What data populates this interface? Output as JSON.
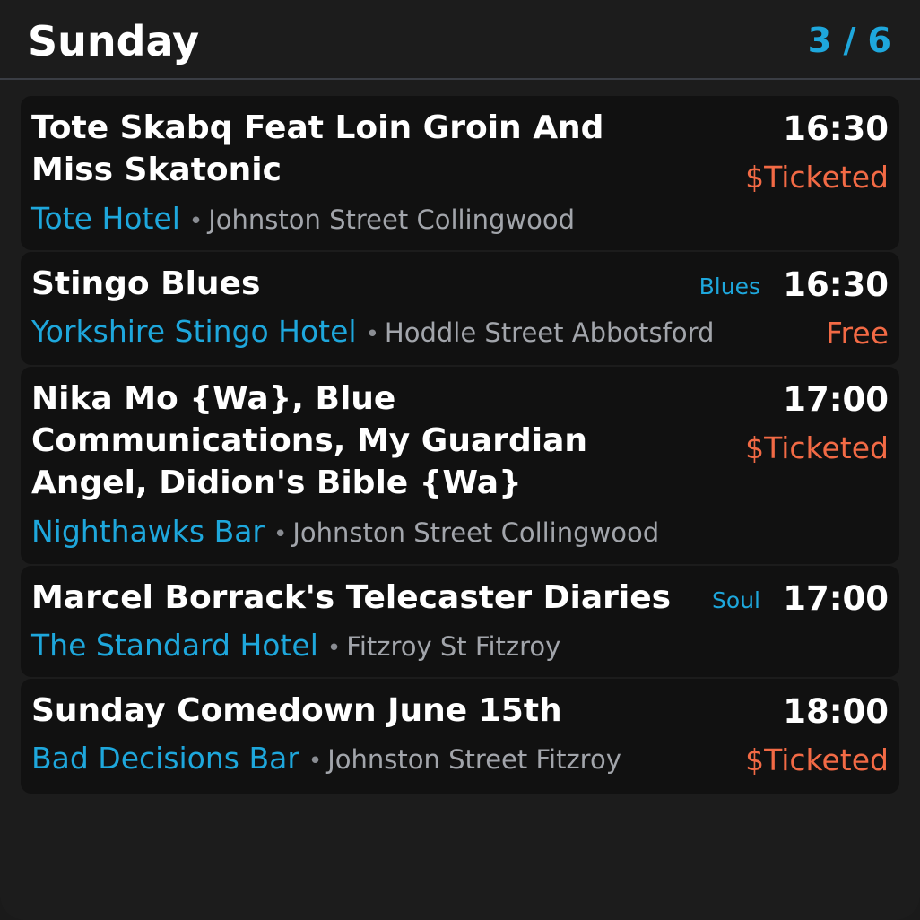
{
  "header": {
    "day": "Sunday",
    "page": "3 / 6"
  },
  "events": [
    {
      "title": "Tote Skabq Feat Loin Groin And Miss Skatonic",
      "time": "16:30",
      "price": "$Ticketed",
      "genre": "",
      "venue": "Tote Hotel",
      "address": "Johnston Street Collingwood"
    },
    {
      "title": "Stingo Blues",
      "time": "16:30",
      "price": "Free",
      "genre": "Blues",
      "venue": "Yorkshire Stingo Hotel",
      "address": "Hoddle Street Abbotsford"
    },
    {
      "title": "Nika Mo {Wa}, Blue Communications, My Guardian Angel, Didion's Bible {Wa}",
      "time": "17:00",
      "price": "$Ticketed",
      "genre": "",
      "venue": "Nighthawks Bar",
      "address": "Johnston Street Collingwood"
    },
    {
      "title": "Marcel Borrack's Telecaster Diaries",
      "time": "17:00",
      "price": "",
      "genre": "Soul",
      "venue": "The Standard Hotel",
      "address": "Fitzroy St Fitzroy"
    },
    {
      "title": "Sunday Comedown June 15th",
      "time": "18:00",
      "price": "$Ticketed",
      "genre": "",
      "venue": "Bad Decisions Bar",
      "address": "Johnston Street Fitzroy"
    }
  ],
  "separator": "•",
  "colors": {
    "background": "#1c1c1c",
    "card": "#111111",
    "accent": "#1ea7dc",
    "price": "#f26a45",
    "muted": "#a2a5ab"
  }
}
